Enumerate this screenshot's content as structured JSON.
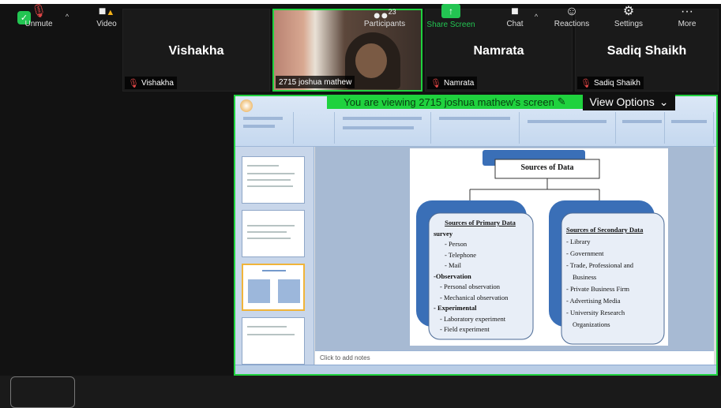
{
  "participants_strip": [
    {
      "name": "Vishakha",
      "tag": "Vishakha"
    },
    {
      "name": "",
      "tag": "2715 joshua mathew"
    },
    {
      "name": "Namrata",
      "tag": "Namrata"
    },
    {
      "name": "Sadiq Shaikh",
      "tag": "Sadiq Shaikh"
    }
  ],
  "share": {
    "banner": "You are viewing 2715 joshua mathew's screen",
    "view_options": "View Options"
  },
  "slide": {
    "title": "Sources of Data",
    "primary": {
      "heading": "Sources of Primary Data",
      "items": [
        "survey",
        "- Person",
        "- Telephone",
        "- Mail",
        "-Observation",
        "- Personal observation",
        "- Mechanical observation",
        "- Experimental",
        "- Laboratory experiment",
        "- Field experiment"
      ]
    },
    "secondary": {
      "heading": "Sources of Secondary Data",
      "items": [
        "- Library",
        "- Government",
        "- Trade, Professional and",
        "Business",
        "- Private Business Firm",
        "- Advertising Media",
        "- University Research",
        "Organizations"
      ]
    },
    "notes_placeholder": "Click to add notes"
  },
  "toolbar": {
    "unmute": "Unmute",
    "video": "Video",
    "participants": "Participants",
    "participants_count": "23",
    "share_screen": "Share Screen",
    "chat": "Chat",
    "reactions": "Reactions",
    "settings": "Settings",
    "more": "More"
  },
  "colors": {
    "accent_green": "#1fd23e",
    "background": "#121212",
    "muted_red": "#e04646"
  }
}
